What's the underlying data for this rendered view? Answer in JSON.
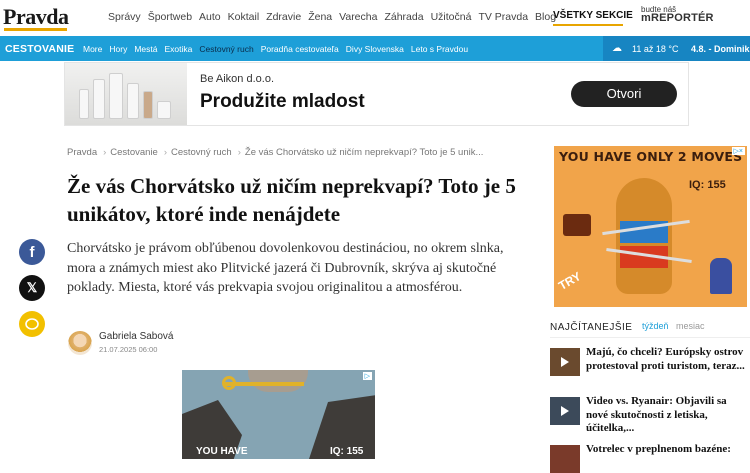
{
  "header": {
    "logo": "Pravda",
    "nav": [
      "Správy",
      "Športweb",
      "Auto",
      "Koktail",
      "Zdravie",
      "Žena",
      "Varecha",
      "Záhrada",
      "Užitočná",
      "TV Pravda",
      "Blog"
    ],
    "all_sections": "VŠETKY SEKCIE",
    "reporter_line1": "budte náš",
    "reporter_brand": "mREPORTÉR"
  },
  "section": {
    "title": "CESTOVANIE",
    "items": [
      "More",
      "Hory",
      "Mestá",
      "Exotika",
      "Cestovný ruch",
      "Poradňa cestovateľa",
      "Divy Slovenska",
      "Leto s Pravdou"
    ],
    "active_index": 4,
    "weather_temp": "11 až 18 °C",
    "weather_name": "4.8. - Dominik",
    "weather_icon": "cloud-icon"
  },
  "ad_banner": {
    "company": "Be Aikon d.o.o.",
    "headline": "Produžite mladost",
    "button": "Otvori"
  },
  "breadcrumb": [
    "Pravda",
    "Cestovanie",
    "Cestovný ruch",
    "Že vás Chorvátsko už ničím neprekvapí? Toto je 5 unik..."
  ],
  "article": {
    "headline": "Že vás Chorvátsko už ničím neprekvapí? Toto je 5 unikátov, ktoré inde nenájdete",
    "perex": "Chorvátsko je právom obľúbenou dovolenkovou destináciou, no okrem slnka, mora a známych miest ako Plitvické jazerá či Dubrovník, skrýva aj skutočné poklady. Miesta, ktoré vás prekvapia svojou originalitou a atmosférou.",
    "author": "Gabriela Sabová",
    "date": "21.07.2025 06:00"
  },
  "inline_ad": {
    "text_left": "YOU HAVE",
    "text_right": "IQ: 155",
    "ad_tag": "▷"
  },
  "game_ad": {
    "title": "YOU HAVE ONLY 2 MOVES",
    "iq": "IQ: 155",
    "try": "TRY",
    "ad_tag": "▷×"
  },
  "most_read": {
    "title": "NAJČÍTANEJŠIE",
    "tab_active": "týždeň",
    "tab_other": "mesiac",
    "items": [
      {
        "text": "Majú, čo chceli? Európsky ostrov protestoval proti turistom, teraz..."
      },
      {
        "text": "Video vs. Ryanair: Objavili sa nové skutočnosti z letiska, účitelka,..."
      },
      {
        "text": "Votrelec v preplnenom bazéne:"
      }
    ]
  }
}
